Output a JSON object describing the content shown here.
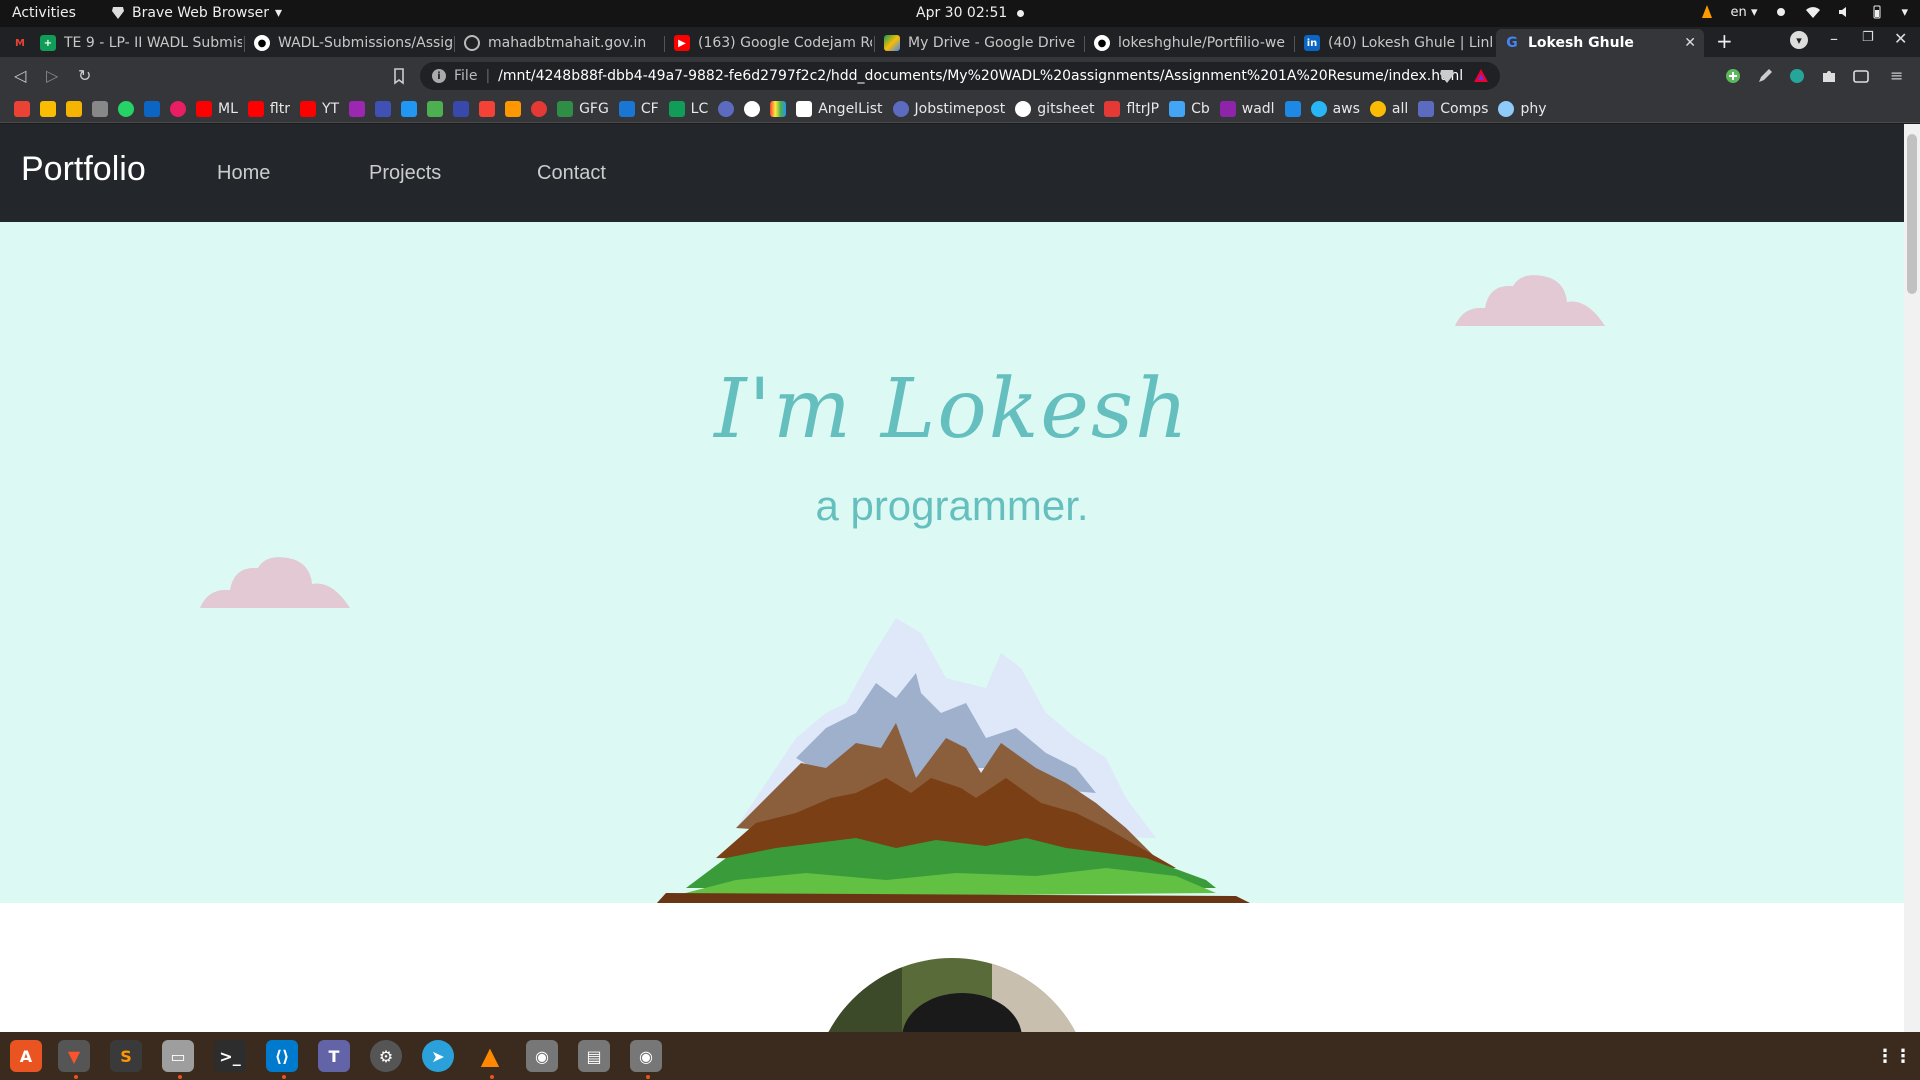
{
  "topbar": {
    "activities": "Activities",
    "app_name": "Brave Web Browser",
    "datetime": "Apr 30  02:51",
    "lang": "en"
  },
  "tabs": [
    {
      "title": "",
      "icon": "gmail-icon",
      "color": "#ea4335"
    },
    {
      "title": "TE 9 - LP- II WADL Submis",
      "icon": "sheets-icon",
      "color": "#0f9d58"
    },
    {
      "title": "WADL-Submissions/Assig",
      "icon": "github-icon",
      "color": "#ffffff"
    },
    {
      "title": "mahadbtmahait.gov.in",
      "icon": "globe-icon",
      "color": "#bbbbbb"
    },
    {
      "title": "(163) Google Codejam Ro",
      "icon": "youtube-icon",
      "color": "#ff0000"
    },
    {
      "title": "My Drive - Google Drive",
      "icon": "drive-icon",
      "color": "#fbbc04"
    },
    {
      "title": "lokeshghule/Portfilio-we",
      "icon": "github-icon",
      "color": "#ffffff"
    },
    {
      "title": "(40) Lokesh Ghule | Linke",
      "icon": "linkedin-icon",
      "color": "#0a66c2"
    },
    {
      "title": "Lokesh Ghule",
      "icon": "google-icon",
      "color": "#4285f4",
      "active": true
    }
  ],
  "toolbar": {
    "scheme": "File",
    "url": "/mnt/4248b88f-dbb4-49a7-9882-fe6d2797f2c2/hdd_documents/My%20WADL%20assignments/Assignment%201A%20Resume/index.html"
  },
  "bookmarks": [
    {
      "label": "",
      "color": "#ea4335"
    },
    {
      "label": "",
      "color": "#fbbc04"
    },
    {
      "label": "",
      "color": "#f4b400"
    },
    {
      "label": "",
      "color": "#888888"
    },
    {
      "label": "",
      "color": "#25d366"
    },
    {
      "label": "",
      "color": "#0a66c2"
    },
    {
      "label": "",
      "color": "#e91e63"
    },
    {
      "label": "ML",
      "color": "#ff0000"
    },
    {
      "label": "fltr",
      "color": "#ff0000"
    },
    {
      "label": "YT",
      "color": "#ff0000"
    },
    {
      "label": "",
      "color": "#9c27b0"
    },
    {
      "label": "",
      "color": "#3f51b5"
    },
    {
      "label": "",
      "color": "#2196f3"
    },
    {
      "label": "",
      "color": "#4caf50"
    },
    {
      "label": "",
      "color": "#3949ab"
    },
    {
      "label": "",
      "color": "#f44336"
    },
    {
      "label": "",
      "color": "#ff9800"
    },
    {
      "label": "",
      "color": "#e53935"
    },
    {
      "label": "GFG",
      "color": "#2f8d46"
    },
    {
      "label": "CF",
      "color": "#1976d2"
    },
    {
      "label": "LC",
      "color": "#0f9d58"
    },
    {
      "label": "",
      "color": "#5c6bc0"
    },
    {
      "label": "",
      "color": "#ffffff"
    },
    {
      "label": "",
      "color": "#ff5722"
    },
    {
      "label": "AngelList",
      "color": "#ffffff"
    },
    {
      "label": "Jobstimepost",
      "color": "#5c6bc0"
    },
    {
      "label": "gitsheet",
      "color": "#ffffff"
    },
    {
      "label": "fltrJP",
      "color": "#e53935"
    },
    {
      "label": "Cb",
      "color": "#42a5f5"
    },
    {
      "label": "wadl",
      "color": "#8e24aa"
    },
    {
      "label": "",
      "color": "#1e88e5"
    },
    {
      "label": "aws",
      "color": "#29b6f6"
    },
    {
      "label": "all",
      "color": "#fbbc04"
    },
    {
      "label": "Comps",
      "color": "#5c6bc0"
    },
    {
      "label": "phy",
      "color": "#90caf9"
    }
  ],
  "page": {
    "brand": "Portfolio",
    "nav_links": [
      "Home",
      "Projects",
      "Contact"
    ],
    "hero_title": "I'm Lokesh",
    "hero_subtitle": "a programmer."
  },
  "colors": {
    "nav_bg": "#23262a",
    "hero_bg": "#dcfaf3",
    "accent": "#66bfbf",
    "cloud": "#e2c9d3"
  },
  "dock": [
    {
      "icon": "ubuntu-software-icon",
      "color": "#e95420"
    },
    {
      "icon": "brave-icon",
      "color": "#fb542b"
    },
    {
      "icon": "sublime-text-icon",
      "color": "#ff9800"
    },
    {
      "icon": "files-icon",
      "color": "#9e9e9e"
    },
    {
      "icon": "terminal-icon",
      "color": "#2d2d2d"
    },
    {
      "icon": "vscode-icon",
      "color": "#007acc"
    },
    {
      "icon": "teams-icon",
      "color": "#6264a7"
    },
    {
      "icon": "settings-icon",
      "color": "#666666"
    },
    {
      "icon": "telegram-icon",
      "color": "#2aa1da"
    },
    {
      "icon": "vlc-icon",
      "color": "#ff8800"
    },
    {
      "icon": "disk-icon",
      "color": "#888888"
    },
    {
      "icon": "drive-mount-icon",
      "color": "#888888"
    },
    {
      "icon": "disk2-icon",
      "color": "#888888"
    }
  ]
}
